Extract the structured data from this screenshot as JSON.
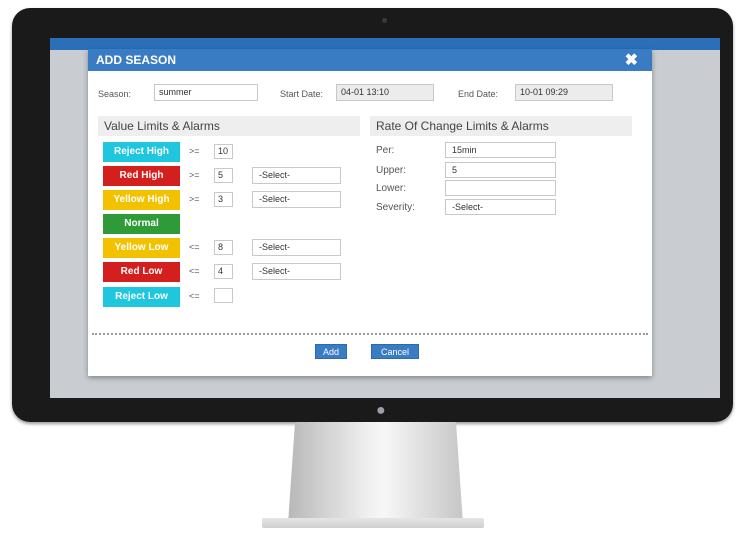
{
  "dialog": {
    "title": "ADD SEASON",
    "close_icon": "close-icon",
    "season_label": "Season:",
    "season_value": "summer",
    "start_label": "Start Date:",
    "start_value": "04-01 13:10",
    "end_label": "End Date:",
    "end_value": "10-01 09:29"
  },
  "value_limits": {
    "title": "Value Limits & Alarms",
    "rows": [
      {
        "tag": "Reject High",
        "color": "#1ec6de",
        "op": ">=",
        "value": "10",
        "select": ""
      },
      {
        "tag": "Red High",
        "color": "#d41f1f",
        "op": ">=",
        "value": "5",
        "select": "-Select-"
      },
      {
        "tag": "Yellow High",
        "color": "#f2c200",
        "op": ">=",
        "value": "3",
        "select": "-Select-"
      },
      {
        "tag": "Normal",
        "color": "#2e9a38",
        "op": "",
        "value": "",
        "select": ""
      },
      {
        "tag": "Yellow Low",
        "color": "#f2c200",
        "op": "<=",
        "value": "8",
        "select": "-Select-"
      },
      {
        "tag": "Red Low",
        "color": "#d41f1f",
        "op": "<=",
        "value": "4",
        "select": "-Select-"
      },
      {
        "tag": "Reject Low",
        "color": "#1ec6de",
        "op": "<=",
        "value": "",
        "select": ""
      }
    ]
  },
  "rate_limits": {
    "title": "Rate Of Change Limits & Alarms",
    "per_label": "Per:",
    "per_value": "15min",
    "upper_label": "Upper:",
    "upper_value": "5",
    "lower_label": "Lower:",
    "lower_value": "",
    "severity_label": "Severity:",
    "severity_value": "-Select-"
  },
  "buttons": {
    "add": "Add",
    "cancel": "Cancel"
  }
}
